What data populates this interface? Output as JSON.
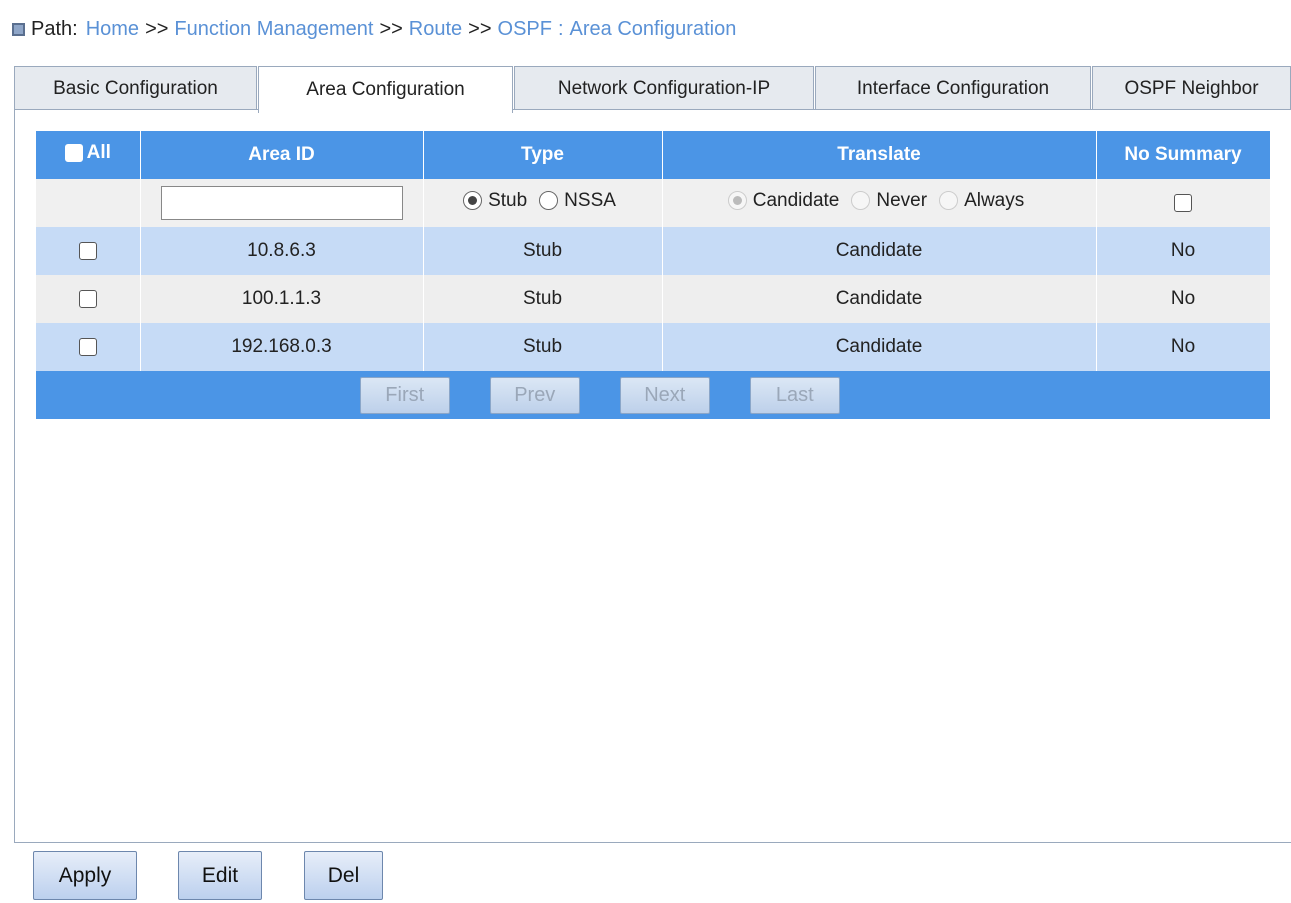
{
  "path": {
    "label": "Path:",
    "home": "Home",
    "sep": ">>",
    "function_management": "Function Management",
    "route": "Route",
    "ospf": "OSPF",
    "colon": ":",
    "area_config": "Area Configuration"
  },
  "tabs": [
    {
      "label": "Basic Configuration"
    },
    {
      "label": "Area Configuration"
    },
    {
      "label": "Network Configuration-IP"
    },
    {
      "label": "Interface Configuration"
    },
    {
      "label": "OSPF Neighbor"
    }
  ],
  "table": {
    "headers": {
      "all": "All",
      "area_id": "Area ID",
      "type": "Type",
      "translate": "Translate",
      "no_summary": "No Summary"
    },
    "input": {
      "area_id_value": "",
      "type_options": [
        "Stub",
        "NSSA"
      ],
      "type_selected": "Stub",
      "translate_options": [
        "Candidate",
        "Never",
        "Always"
      ],
      "translate_selected": "Candidate"
    },
    "rows": [
      {
        "area_id": "10.8.6.3",
        "type": "Stub",
        "translate": "Candidate",
        "no_summary": "No"
      },
      {
        "area_id": "100.1.1.3",
        "type": "Stub",
        "translate": "Candidate",
        "no_summary": "No"
      },
      {
        "area_id": "192.168.0.3",
        "type": "Stub",
        "translate": "Candidate",
        "no_summary": "No"
      }
    ],
    "pager": {
      "first": "First",
      "prev": "Prev",
      "next": "Next",
      "last": "Last"
    }
  },
  "buttons": {
    "apply": "Apply",
    "edit": "Edit",
    "del": "Del"
  }
}
